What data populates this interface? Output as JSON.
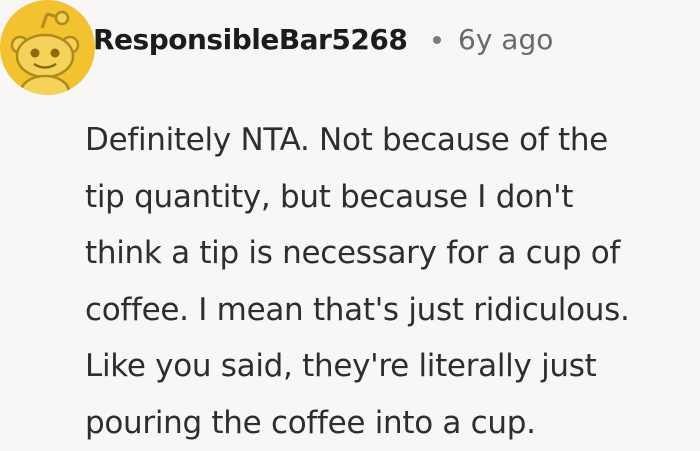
{
  "comment": {
    "author": "ResponsibleBar5268",
    "separator_icon": "dot-separator",
    "timestamp": "6y ago",
    "avatar_icon": "reddit-snoo-avatar-icon",
    "avatar_color": "#f2c230",
    "body": "Definitely NTA. Not because of the\ntip quantity, but because I don't\nthink a tip is necessary for a cup of\ncoffee. I mean that's just ridiculous.\nLike you said, they're literally just\npouring the coffee into a cup."
  }
}
